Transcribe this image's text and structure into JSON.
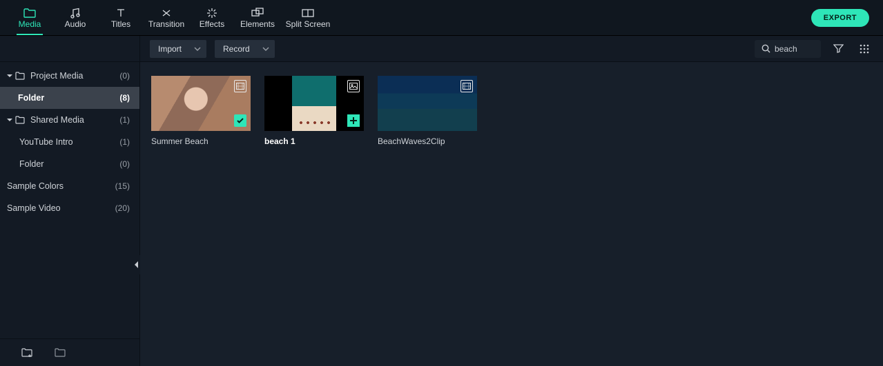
{
  "tabs": [
    {
      "id": "media",
      "label": "Media"
    },
    {
      "id": "audio",
      "label": "Audio"
    },
    {
      "id": "titles",
      "label": "Titles"
    },
    {
      "id": "transition",
      "label": "Transition"
    },
    {
      "id": "effects",
      "label": "Effects"
    },
    {
      "id": "elements",
      "label": "Elements"
    },
    {
      "id": "splitscreen",
      "label": "Split Screen"
    }
  ],
  "active_tab": "media",
  "export_label": "EXPORT",
  "toolbar": {
    "import_label": "Import",
    "record_label": "Record"
  },
  "search": {
    "value": "beach"
  },
  "sidebar": {
    "items": [
      {
        "label": "Project Media",
        "count": "(0)",
        "level": 0,
        "hasTwisty": true,
        "hasFolderIcon": true
      },
      {
        "label": "Folder",
        "count": "(8)",
        "level": 1,
        "selected": true
      },
      {
        "label": "Shared Media",
        "count": "(1)",
        "level": 0,
        "hasTwisty": true,
        "hasFolderIcon": true
      },
      {
        "label": "YouTube Intro",
        "count": "(1)",
        "level": 1
      },
      {
        "label": "Folder",
        "count": "(0)",
        "level": 1
      },
      {
        "label": "Sample Colors",
        "count": "(15)",
        "level": 0
      },
      {
        "label": "Sample Video",
        "count": "(20)",
        "level": 0
      }
    ]
  },
  "clips": [
    {
      "name": "Summer Beach",
      "type": "video",
      "checked": true
    },
    {
      "name": "beach 1",
      "type": "image",
      "selected": true,
      "addable": true
    },
    {
      "name": "BeachWaves2Clip",
      "type": "video"
    }
  ]
}
